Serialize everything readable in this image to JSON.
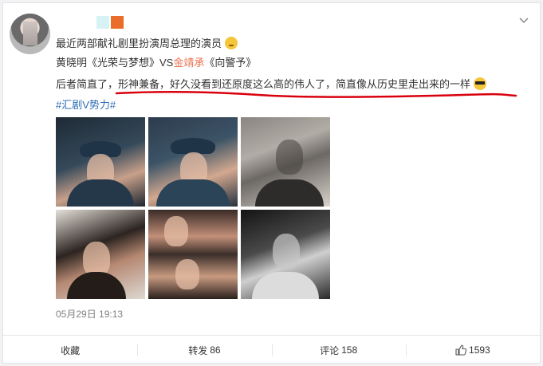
{
  "post": {
    "line1": "最近两部献礼剧里扮演周总理的演员",
    "line2_prefix": "黄晓明《光荣与梦想》VS",
    "line2_red": "金靖承",
    "line2_suffix": "《向警予》",
    "line3_a": "后者简直了，",
    "line3_b": "形神兼备，好久没看到还原度这么高的伟人了，简直像从历史里走出来的一样",
    "hashtag": "#汇剧V势力#",
    "time": "05月29日 19:13"
  },
  "actions": {
    "favorite": "收藏",
    "repost_label": "转发",
    "repost_count": "86",
    "comment_label": "评论",
    "comment_count": "158",
    "like_count": "1593"
  },
  "colors": {
    "accent_red": "#eb7350",
    "link_blue": "#2d6cb5",
    "underline_red": "#d9000e"
  },
  "icons": {
    "menu": "chevron-down-icon",
    "like": "thumbs-up-icon",
    "emoji_think": "thinking-emoji-icon",
    "emoji_cool": "sunglasses-emoji-icon"
  }
}
